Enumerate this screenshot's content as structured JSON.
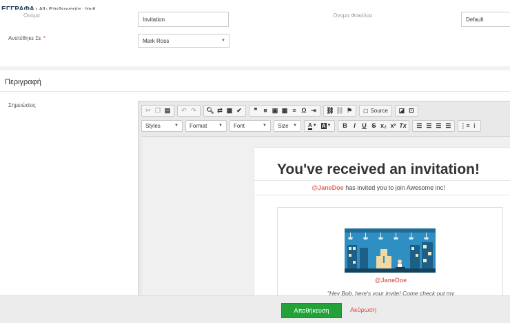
{
  "breadcrumb": {
    "main": "ΕΓΓΡΑΦΑ",
    "items": [
      "All",
      "Επεξεργασία : Invit..."
    ]
  },
  "form": {
    "name_label": "Ονομα",
    "name_value": "Invitation",
    "assigned_label": "Ανατέθηκε Σε",
    "assigned_value": "Mark Ross",
    "file_label": "Ονομα Φακέλου",
    "folder_value": "Default",
    "required_mark": "*"
  },
  "section": {
    "title": "Περιγραφή",
    "notes_label": "Σημειώσεις"
  },
  "toolbar": {
    "row1": {
      "clipboard": [
        "cut-icon",
        "copy-icon",
        "paste-icon"
      ],
      "undo": [
        "undo-icon",
        "redo-icon"
      ],
      "find": [
        "find-icon",
        "replace-icon",
        "format-painter-icon",
        "spellcheck-icon"
      ],
      "insert": [
        "blockquote-icon",
        "special-icon",
        "image-icon",
        "table-icon",
        "horizontal-rule-icon",
        "omega-icon",
        "iframe-icon"
      ],
      "links": [
        "link-icon",
        "unlink-icon",
        "anchor-icon"
      ],
      "source_label": "Source",
      "doc": [
        "preview-icon",
        "print-icon"
      ]
    },
    "row2": {
      "styles_label": "Styles",
      "format_label": "Format",
      "font_label": "Font",
      "size_label": "Size",
      "text_color_label": "A",
      "bg_color_label": "A",
      "bold": "B",
      "italic": "I",
      "underline": "U",
      "strike": "S",
      "subscript": "x₂",
      "superscript": "x²",
      "clear_format": "Tx"
    }
  },
  "email": {
    "title": "You've received an invitation!",
    "mention": "@JaneDoe",
    "subtitle_rest": " has invited you to join Awesome inc!",
    "card_name": "@JaneDoe",
    "card_quote": "\"Hey Bob, here's your invite! Come check out my"
  },
  "footer": {
    "save_label": "Αποθήκευση",
    "cancel_label": "Ακύρωση"
  },
  "colors": {
    "save_green": "#23a23a",
    "cancel_red": "#e04848",
    "mention_red": "#e06767",
    "breadcrumb_blue": "#1e3a5a"
  }
}
